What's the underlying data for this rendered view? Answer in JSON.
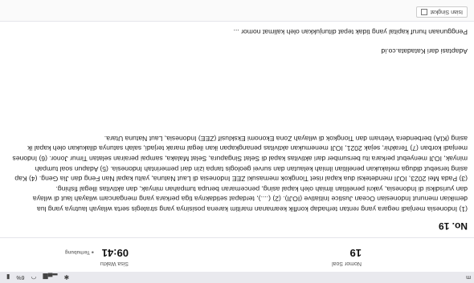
{
  "statusbar": {
    "time": "m",
    "battery_label": "6%"
  },
  "header": {
    "question_label": "Nomor Soal",
    "question_number": "19",
    "time_label": "Sisa Waktu",
    "time_value": "09:41",
    "time_status": "Terhubung"
  },
  "question": {
    "number_label": "No. 19",
    "paragraph_lines": [
      "(1) Indonesia menjadi negara yang rentan terhadap konflik keamanan maritim karena posisinya yang strategis serta wilayah lautnya yang lua",
      "demikian menurut Indonesian Ocean Justice Initiative (IOJI). (2) (....), terdapat setidaknya tiga perkara yang mengancam wilayah laut di wilaya",
      "dan yurisdiksi di Indonesia, yakni penelitian ilmiah oleh kapal asing, pencemaran berupa tumpahan minyak, dan aktivitas illegal fishing.",
      "(3) Pada Mei 2023, IOJI mendeteksi dua kapal riset Tiongkok memasuki ZEE Indonesia di Laut Natuna, yaitu kapal Nan Feng dan Jia Geng. (4) Kap",
      "asing tersebut diduga melakukan penelitian ilmiah kelautan dan survei geologis tanpa izin dari pemerintah Indonesia. (5) Adapun soal tumpah",
      "minyak, IOJI menyebut perkara itu bersumber dari aktivitas kapal di Selat Singapura, Selat Malaka, sampai perairan selatan Timur Jonor. (6) Indones",
      "menjadi korban (7) Terakhir, sejak 2021, IOJI menemukan aktivitas penangkapan ikan ilegal marak terjadi, salah satunya dilakukan oleh kapal ik",
      "asing (KIA) berbendera Vietnam dan Tiongkok di wilayah Zona Ekonomi Eksklusif (ZEE) Indonesia, Laut Natuna Utara."
    ],
    "source": "Adaptasi dari Katadata.co.id",
    "prompt": "Penggunaan huruf kapital yang tidak tepat ditunjukkan oleh kalimat nomor ..."
  },
  "footer": {
    "flag_label": "Isian Singkat"
  }
}
